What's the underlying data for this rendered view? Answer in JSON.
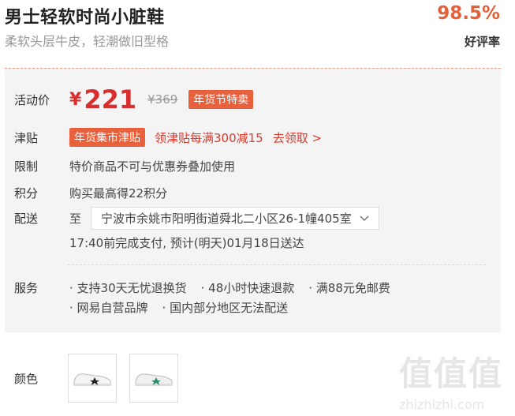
{
  "product": {
    "title": "男士轻软时尚小脏鞋",
    "subtitle": "柔软头层牛皮，轻潮做旧型格"
  },
  "rating": {
    "value": "98.5%",
    "label": "好评率"
  },
  "price": {
    "label": "活动价",
    "currency": "¥",
    "current": "221",
    "original": "¥369",
    "tag": "年货节特卖"
  },
  "subsidy": {
    "label": "津贴",
    "tag": "年货集市津贴",
    "link": "领津贴每满300减15",
    "claim": "去领取 >"
  },
  "limit": {
    "label": "限制",
    "text": "特价商品不可与优惠券叠加使用"
  },
  "points": {
    "label": "积分",
    "text": "购买最高得22积分"
  },
  "delivery": {
    "label": "配送",
    "to": "至",
    "address": "宁波市余姚市阳明街道舜北二小区26-1幢405室",
    "eta": "17:40前完成支付, 预计(明天)01月18日送达"
  },
  "service": {
    "label": "服务",
    "items": [
      "· 支持30天无忧退换货",
      "· 48小时快速退款",
      "· 满88元免邮费",
      "· 网易自营品牌",
      "· 国内部分地区无法配送"
    ]
  },
  "color": {
    "label": "颜色"
  },
  "watermark": {
    "title": "值值值",
    "url": "zhizhizhi.com"
  },
  "colors": {
    "accent": "#e8603c",
    "price": "#d92e2e",
    "rating": "#e4603a"
  }
}
